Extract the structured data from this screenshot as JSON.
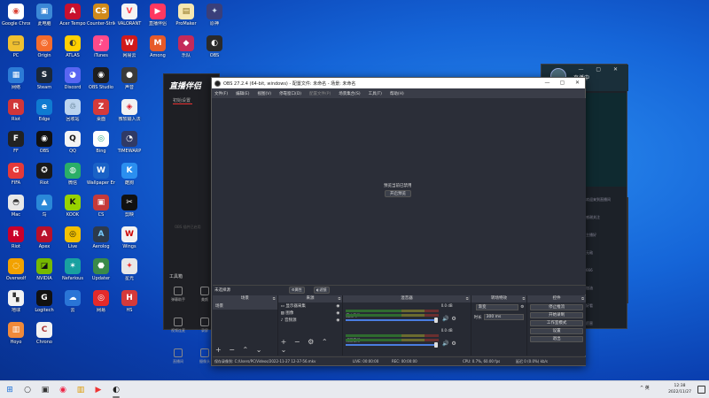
{
  "desktop": {
    "icons": [
      {
        "label": "Google Chrome",
        "color": "#ffffff",
        "glyph": "◉",
        "fg": "#db4437"
      },
      {
        "label": "此电脑",
        "color": "#3b88d6",
        "glyph": "▣",
        "fg": "#fff"
      },
      {
        "label": "Acer Tempo",
        "color": "#c8102e",
        "glyph": "A",
        "fg": "#fff"
      },
      {
        "label": "Counter-Strike",
        "color": "#d08a1a",
        "glyph": "CS",
        "fg": "#fff"
      },
      {
        "label": "VALORANT",
        "color": "#f4f4f4",
        "glyph": "V",
        "fg": "#ff4655"
      },
      {
        "label": "直播伴侣",
        "color": "#ff3860",
        "glyph": "▶",
        "fg": "#fff"
      },
      {
        "label": "ProMaker",
        "color": "#f6e7b0",
        "glyph": "▤",
        "fg": "#8a6d1a"
      },
      {
        "label": "原神",
        "color": "#3a3f7a",
        "glyph": "✦",
        "fg": "#cde"
      },
      {
        "label": "PC",
        "color": "#f0c030",
        "glyph": "▭",
        "fg": "#333"
      },
      {
        "label": "Origin",
        "color": "#f56c2d",
        "glyph": "◎",
        "fg": "#fff"
      },
      {
        "label": "ATLAS",
        "color": "#ffd000",
        "glyph": "◐",
        "fg": "#333"
      },
      {
        "label": "iTunes",
        "color": "#ff4a8a",
        "glyph": "♪",
        "fg": "#fff"
      },
      {
        "label": "网易云",
        "color": "#d11a1a",
        "glyph": "W",
        "fg": "#fff"
      },
      {
        "label": "Among",
        "color": "#e65a2a",
        "glyph": "M",
        "fg": "#fff"
      },
      {
        "label": "乐队",
        "color": "#c42a5a",
        "glyph": "◆",
        "fg": "#fff"
      },
      {
        "label": "OBS",
        "color": "#2a2a2a",
        "glyph": "◐",
        "fg": "#fff"
      },
      {
        "label": "网络",
        "color": "#2c7bd6",
        "glyph": "▦",
        "fg": "#fff"
      },
      {
        "label": "Steam",
        "color": "#1b2838",
        "glyph": "S",
        "fg": "#fff"
      },
      {
        "label": "Discord",
        "color": "#5865f2",
        "glyph": "◕",
        "fg": "#fff"
      },
      {
        "label": "OBS Studio",
        "color": "#1e1e1e",
        "glyph": "◉",
        "fg": "#fff"
      },
      {
        "label": "声音",
        "color": "#3a3a3a",
        "glyph": "●",
        "fg": "#fff"
      },
      {
        "label": "Riot",
        "color": "#d13639",
        "glyph": "R",
        "fg": "#fff"
      },
      {
        "label": "Edge",
        "color": "#0f7bd1",
        "glyph": "e",
        "fg": "#fff"
      },
      {
        "label": "回收站",
        "color": "#bcd4ee",
        "glyph": "♲",
        "fg": "#245"
      },
      {
        "label": "桌面",
        "color": "#d43a3a",
        "glyph": "Z",
        "fg": "#fff"
      },
      {
        "label": "微软输入法",
        "color": "#f2f2f2",
        "glyph": "◈",
        "fg": "#d23"
      },
      {
        "label": "FF",
        "color": "#222",
        "glyph": "F",
        "fg": "#fff"
      },
      {
        "label": "OBS",
        "color": "#111",
        "glyph": "◉",
        "fg": "#fff"
      },
      {
        "label": "QQ",
        "color": "#f4f4f4",
        "glyph": "Q",
        "fg": "#111"
      },
      {
        "label": "Bing",
        "color": "#fff",
        "glyph": "◎",
        "fg": "#3a8"
      },
      {
        "label": "TIMEWARP",
        "color": "#303a66",
        "glyph": "◔",
        "fg": "#fff"
      },
      {
        "label": "FIFA",
        "color": "#e53a3a",
        "glyph": "G",
        "fg": "#fff"
      },
      {
        "label": "Riot",
        "color": "#1a1a1a",
        "glyph": "✪",
        "fg": "#fff"
      },
      {
        "label": "微信",
        "color": "#2aae67",
        "glyph": "◍",
        "fg": "#fff"
      },
      {
        "label": "Wallpaper Engine",
        "color": "#1a62c6",
        "glyph": "W",
        "fg": "#fff"
      },
      {
        "label": "酷狗",
        "color": "#2b8ff0",
        "glyph": "K",
        "fg": "#fff"
      },
      {
        "label": "Mac",
        "color": "#e8e8e8",
        "glyph": "◓",
        "fg": "#333"
      },
      {
        "label": "鸟",
        "color": "#2a88d8",
        "glyph": "▲",
        "fg": "#fff"
      },
      {
        "label": "KOOK",
        "color": "#97d300",
        "glyph": "K",
        "fg": "#111"
      },
      {
        "label": "CS",
        "color": "#c53a3a",
        "glyph": "▣",
        "fg": "#fff"
      },
      {
        "label": "剪映",
        "color": "#111",
        "glyph": "✂",
        "fg": "#fff"
      },
      {
        "label": "Riot",
        "color": "#c9002b",
        "glyph": "R",
        "fg": "#fff"
      },
      {
        "label": "Apex",
        "color": "#b9102a",
        "glyph": "A",
        "fg": "#fff"
      },
      {
        "label": "Live",
        "color": "#f2c000",
        "glyph": "◎",
        "fg": "#111"
      },
      {
        "label": "Aerolog",
        "color": "#2d3a4c",
        "glyph": "A",
        "fg": "#7cf"
      },
      {
        "label": "Wings",
        "color": "#f2f2f2",
        "glyph": "W",
        "fg": "#c00"
      },
      {
        "label": "Overwolf",
        "color": "#f2a200",
        "glyph": "◌",
        "fg": "#fff"
      },
      {
        "label": "NVIDIA",
        "color": "#76b900",
        "glyph": "◪",
        "fg": "#111"
      },
      {
        "label": "Nefarious",
        "color": "#19a0a0",
        "glyph": "✶",
        "fg": "#fff"
      },
      {
        "label": "Updater",
        "color": "#3a8a4a",
        "glyph": "⬣",
        "fg": "#fff"
      },
      {
        "label": "星光",
        "color": "#e8e8e8",
        "glyph": "✦",
        "fg": "#e33"
      },
      {
        "label": "地球",
        "color": "#f2f2f2",
        "glyph": "▚",
        "fg": "#333"
      },
      {
        "label": "Logitech",
        "color": "#111",
        "glyph": "G",
        "fg": "#fff"
      },
      {
        "label": "云",
        "color": "#2a75d6",
        "glyph": "☁",
        "fg": "#fff"
      },
      {
        "label": "网易",
        "color": "#e42a2a",
        "glyph": "◎",
        "fg": "#fff"
      },
      {
        "label": "HS",
        "color": "#d43a3a",
        "glyph": "H",
        "fg": "#fff"
      },
      {
        "label": "Hoyo",
        "color": "#f08a3a",
        "glyph": "▥",
        "fg": "#fff"
      },
      {
        "label": "Chrono",
        "color": "#f2f2f2",
        "glyph": "C",
        "fg": "#a33"
      }
    ]
  },
  "bg_app": {
    "logo": "直播伴侣",
    "tab": "初始设置",
    "side_text": "OBS 插件已启用",
    "tools_title": "工具箱",
    "tools": [
      "弹幕助手",
      "美颜",
      "视频连麦",
      "录屏",
      "直播间",
      "摄像头"
    ],
    "notice": "关联抖主播，粉丝已关注..."
  },
  "right_panel": {
    "title": "直播中",
    "chat_rows": [
      "欢迎来到直播间",
      "感谢关注",
      "主播好",
      "无敌",
      "666",
      "加油",
      "好看",
      "厉害"
    ]
  },
  "obs": {
    "title": "OBS 27.2.4 (64-bit, windows) - 配置文件: 未命名 - 场景: 未命名",
    "menus": [
      "文件(F)",
      "编辑(E)",
      "视图(V)",
      "停靠窗口(D)",
      "配置文件(P)",
      "场景集合(S)",
      "工具(T)",
      "帮助(H)"
    ],
    "preview_text": "预览当前已禁用",
    "preview_button": "开启预览",
    "scene_label": "未选择源",
    "props_button": "属性",
    "filters_button": "滤镜",
    "docks": {
      "scenes": {
        "title": "场景",
        "items": [
          "场景"
        ]
      },
      "sources": {
        "title": "来源",
        "items": [
          "显示器采集",
          "图像",
          "音频源"
        ]
      },
      "mixer": {
        "title": "混音器",
        "tracks": [
          {
            "name": "麦克风/Aux",
            "db": "0.0 dB",
            "level": 1.0
          },
          {
            "name": "桌面音频",
            "db": "0.0 dB",
            "level": 1.0
          }
        ]
      },
      "transitions": {
        "title": "转场特效",
        "type": "渐变",
        "duration_label": "时长",
        "duration": "300 ms"
      },
      "controls": {
        "title": "控件",
        "buttons": [
          "停止推流",
          "开始录制",
          "工作室模式",
          "设置",
          "退出"
        ]
      }
    },
    "status": {
      "recording_path": "保存录像到: C:/Users/PC/Videos/2022-11-27 12-37-56.mkv",
      "live": "LIVE: 00:00:00",
      "rec": "REC: 00:00:00",
      "cpu": "CPU: 0.7%, 60.00 fps",
      "kbps": "延迟 0 (0.0%) kb/s"
    }
  },
  "taskbar": {
    "tray": "^  英",
    "time": "12:38",
    "date": "2022/11/27"
  },
  "colors": {
    "accent": "#4a7de0",
    "obs_bg": "#2b2e38",
    "taskbar_bg": "#e8eaef"
  }
}
